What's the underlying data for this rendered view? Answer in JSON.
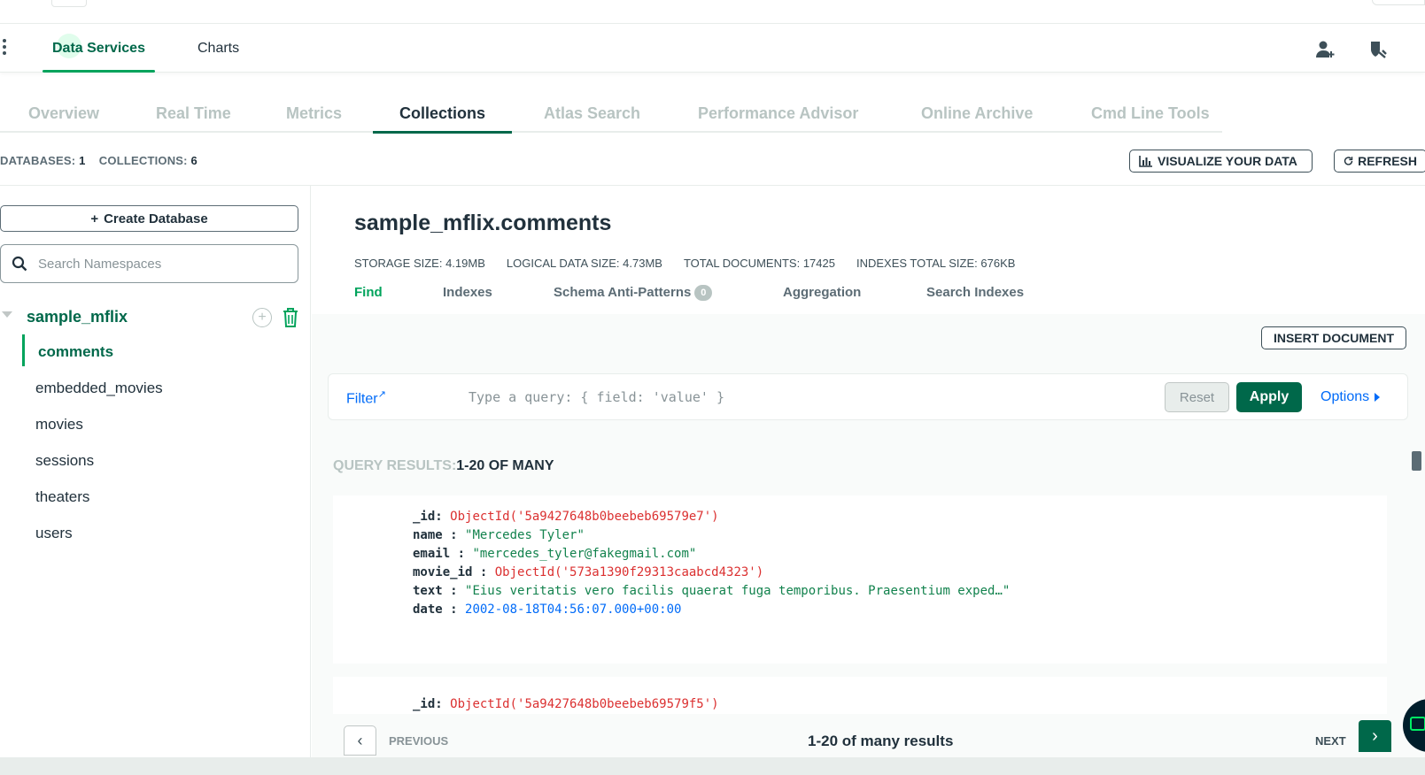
{
  "product_bar": {
    "tabs": [
      {
        "label": "Data Services",
        "active": true
      },
      {
        "label": "Charts",
        "active": false
      }
    ],
    "icons": [
      "user-add-icon",
      "user-shield-icon"
    ]
  },
  "nav": {
    "tabs": [
      "Overview",
      "Real Time",
      "Metrics",
      "Collections",
      "Atlas Search",
      "Performance Advisor",
      "Online Archive",
      "Cmd Line Tools"
    ],
    "active": "Collections"
  },
  "counts": {
    "databases_label": "DATABASES:",
    "databases_value": "1",
    "collections_label": "COLLECTIONS:",
    "collections_value": "6"
  },
  "header_buttons": {
    "visualize": "VISUALIZE YOUR DATA",
    "refresh": "REFRESH"
  },
  "sidebar": {
    "create_database": "Create Database",
    "search_placeholder": "Search Namespaces",
    "database": "sample_mflix",
    "collections": [
      "comments",
      "embedded_movies",
      "movies",
      "sessions",
      "theaters",
      "users"
    ],
    "active_collection": "comments"
  },
  "namespace": {
    "title": "sample_mflix.comments",
    "stats": [
      {
        "label": "STORAGE SIZE:",
        "value": "4.19MB"
      },
      {
        "label": "LOGICAL DATA SIZE:",
        "value": "4.73MB"
      },
      {
        "label": "TOTAL DOCUMENTS:",
        "value": "17425"
      },
      {
        "label": "INDEXES TOTAL SIZE:",
        "value": "676KB"
      }
    ],
    "tabs": [
      "Find",
      "Indexes",
      "Schema Anti-Patterns",
      "Aggregation",
      "Search Indexes"
    ],
    "schema_badge": "0",
    "active_tab": "Find"
  },
  "toolbar": {
    "insert_document": "INSERT DOCUMENT"
  },
  "filter": {
    "label": "Filter",
    "placeholder": "Type a query: { field: 'value' }",
    "reset": "Reset",
    "apply": "Apply",
    "options": "Options"
  },
  "results": {
    "label": "QUERY RESULTS:",
    "range": "1-20 OF MANY"
  },
  "documents": [
    {
      "fields": [
        {
          "key": "_id:",
          "value": "ObjectId('5a9427648b0beebeb69579e7')",
          "type": "oid"
        },
        {
          "key": "name :",
          "value": "\"Mercedes Tyler\"",
          "type": "str"
        },
        {
          "key": "email :",
          "value": "\"mercedes_tyler@fakegmail.com\"",
          "type": "str"
        },
        {
          "key": "movie_id :",
          "value": "ObjectId('573a1390f29313caabcd4323')",
          "type": "oid"
        },
        {
          "key": "text :",
          "value": "\"Eius veritatis vero facilis quaerat fuga temporibus. Praesentium exped…\"",
          "type": "str"
        },
        {
          "key": "date :",
          "value": "2002-08-18T04:56:07.000+00:00",
          "type": "date"
        }
      ]
    },
    {
      "fields": [
        {
          "key": "_id:",
          "value": "ObjectId('5a9427648b0beebeb69579f5')",
          "type": "oid"
        }
      ]
    }
  ],
  "pager": {
    "previous": "PREVIOUS",
    "summary": "1-20 of many results",
    "next": "NEXT"
  },
  "colors": {
    "brand_green": "#00684a",
    "accent_green": "#00a35c",
    "link_blue": "#016bf8",
    "oid_red": "#db3030"
  }
}
